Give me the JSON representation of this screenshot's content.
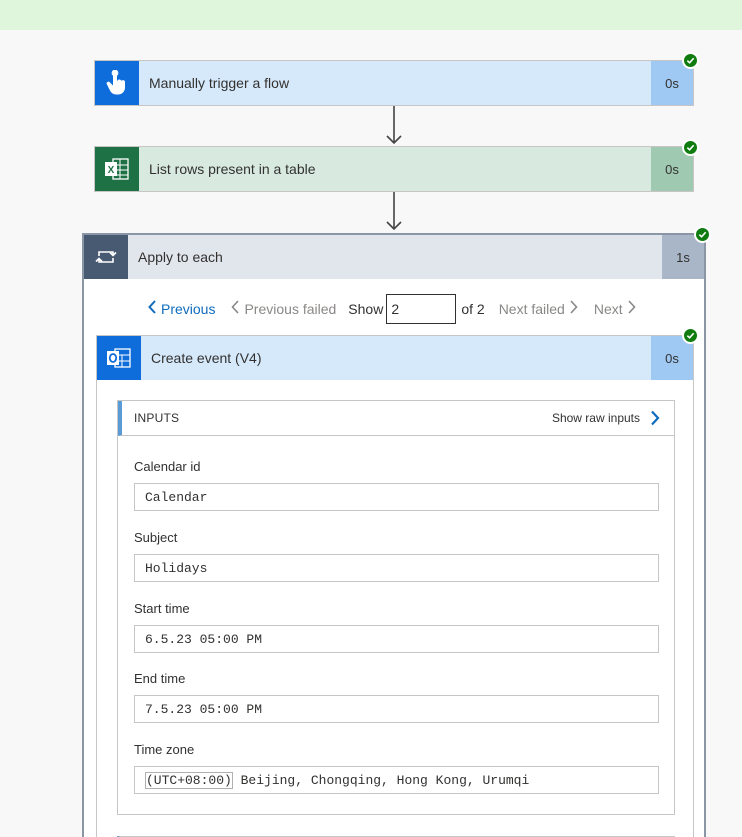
{
  "flow": {
    "steps": [
      {
        "title": "Manually trigger a flow",
        "duration": "0s",
        "icon": "hand-tap-icon",
        "status": "succeeded"
      },
      {
        "title": "List rows present in a table",
        "duration": "0s",
        "icon": "excel-icon",
        "status": "succeeded"
      }
    ],
    "loop": {
      "title": "Apply to each",
      "duration": "1s",
      "icon": "loop-icon",
      "status": "succeeded",
      "pager": {
        "previous": "Previous",
        "previous_failed": "Previous failed",
        "show_label": "Show",
        "current": "2",
        "of_label": "of 2",
        "next_failed": "Next failed",
        "next": "Next"
      },
      "action": {
        "title": "Create event (V4)",
        "duration": "0s",
        "icon": "outlook-icon",
        "status": "succeeded",
        "inputs": {
          "header": "INPUTS",
          "show_raw": "Show raw inputs",
          "fields": [
            {
              "label": "Calendar id",
              "value": "Calendar"
            },
            {
              "label": "Subject",
              "value": "Holidays"
            },
            {
              "label": "Start time",
              "value": "6.5.23 05:00 PM"
            },
            {
              "label": "End time",
              "value": "7.5.23 05:00 PM"
            },
            {
              "label": "Time zone",
              "value_marked": "(UTC+08:00)",
              "value_rest": " Beijing, Chongqing, Hong Kong, Urumqi"
            }
          ]
        }
      }
    }
  },
  "colors": {
    "success": "#107c10",
    "link": "#0f6cbd",
    "trigger_accent": "#0f6cdb",
    "excel_accent": "#1e7145",
    "loop_accent": "#485a72"
  }
}
